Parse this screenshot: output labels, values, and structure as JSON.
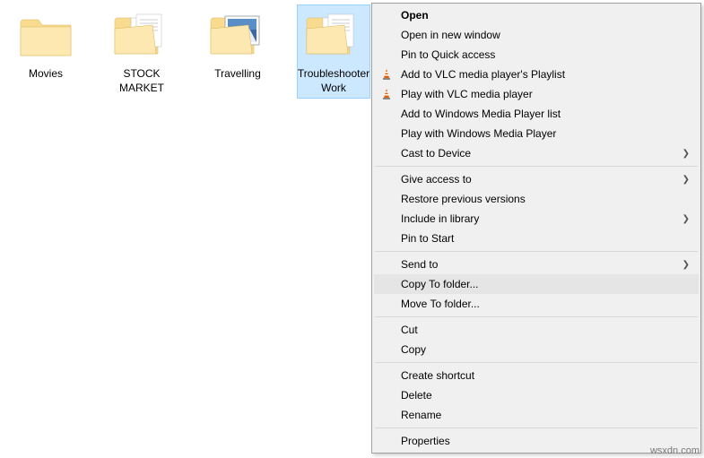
{
  "folders": [
    {
      "label": "Movies",
      "type": "plain"
    },
    {
      "label": "STOCK MARKET",
      "type": "docs"
    },
    {
      "label": "Travelling",
      "type": "picture"
    },
    {
      "label": "Troubleshooter Work",
      "type": "docs",
      "selected": true
    }
  ],
  "context_menu": {
    "groups": [
      [
        {
          "label": "Open",
          "bold": true
        },
        {
          "label": "Open in new window"
        },
        {
          "label": "Pin to Quick access"
        },
        {
          "label": "Add to VLC media player's Playlist",
          "icon": "vlc"
        },
        {
          "label": "Play with VLC media player",
          "icon": "vlc"
        },
        {
          "label": "Add to Windows Media Player list"
        },
        {
          "label": "Play with Windows Media Player"
        },
        {
          "label": "Cast to Device",
          "submenu": true
        }
      ],
      [
        {
          "label": "Give access to",
          "submenu": true
        },
        {
          "label": "Restore previous versions"
        },
        {
          "label": "Include in library",
          "submenu": true
        },
        {
          "label": "Pin to Start"
        }
      ],
      [
        {
          "label": "Send to",
          "submenu": true
        },
        {
          "label": "Copy To folder...",
          "highlighted": true
        },
        {
          "label": "Move To folder..."
        }
      ],
      [
        {
          "label": "Cut"
        },
        {
          "label": "Copy"
        }
      ],
      [
        {
          "label": "Create shortcut"
        },
        {
          "label": "Delete"
        },
        {
          "label": "Rename"
        }
      ],
      [
        {
          "label": "Properties"
        }
      ]
    ]
  },
  "watermark": "wsxdn.com"
}
